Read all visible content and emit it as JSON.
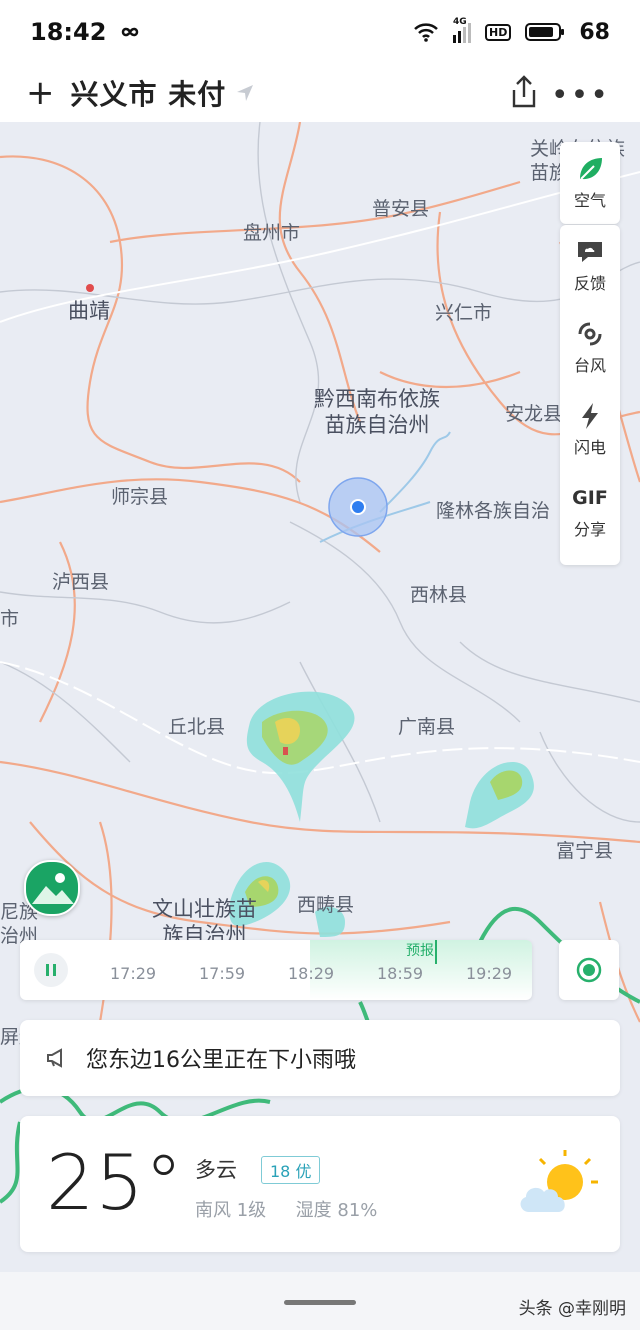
{
  "status_bar": {
    "time": "18:42",
    "network": "4G",
    "hd": "HD",
    "battery": "68"
  },
  "header": {
    "location_title": "兴义市 未付"
  },
  "map": {
    "labels": {
      "guanling": "关岭布依族",
      "miaozu": "苗族",
      "puan": "普安县",
      "panzhou": "盘州市",
      "qujing": "曲靖",
      "xingren": "兴仁市",
      "qianxinan": "黔西南布依族\n苗族自治州",
      "anlong": "安龙县",
      "shizong": "师宗县",
      "longlin": "隆林各族自治",
      "luxi": "泸西县",
      "xilin": "西林县",
      "shi_left": "市",
      "qiubei": "丘北县",
      "guangnan": "广南县",
      "funing": "富宁县",
      "wenshan": "文山壮族苗\n族自治州",
      "xichou": "西畴县",
      "nizu": "尼族\n治州",
      "pingbian": "屏边"
    }
  },
  "side_panel": {
    "air_label": "空气",
    "feedback_label": "反馈",
    "typhoon_label": "台风",
    "lightning_label": "闪电",
    "gif_text": "GIF",
    "share_label": "分享"
  },
  "timeline": {
    "forecast_label": "预报",
    "ticks": [
      "17:29",
      "17:59",
      "18:29",
      "18:59",
      "19:29"
    ]
  },
  "notice": {
    "text": "您东边16公里正在下小雨哦"
  },
  "weather": {
    "temperature": "25°",
    "condition": "多云",
    "aqi": "18 优",
    "wind": "南风 1级",
    "humidity": "湿度 81%"
  },
  "watermark": "头条 @幸刚明"
}
